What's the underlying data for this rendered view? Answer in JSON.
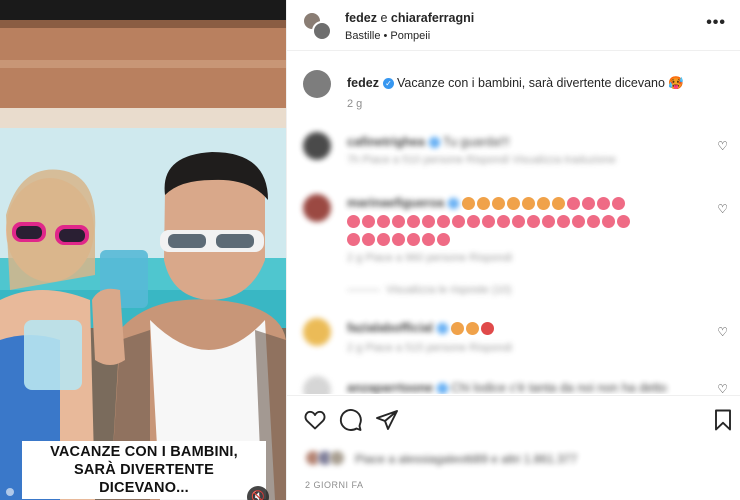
{
  "post": {
    "authors": {
      "first": "fedez",
      "conjunction": "e",
      "second": "chiaraferragni"
    },
    "location": "Bastille • Pompeii",
    "more_icon": "more-horizontal-icon",
    "caption": {
      "username": "fedez",
      "text": "Vacanze con i bambini, sarà divertente dicevano 🥵",
      "time": "2 g"
    },
    "media_overlay": {
      "line1": "VACANZE CON I BAMBINI,",
      "line2": "SARÀ DIVERTENTE DICEVANO..."
    },
    "date_label": "2 GIORNI FA"
  },
  "comments": [
    {
      "username": "cafinetrighea",
      "text": "Tu guarda!!!",
      "meta": "7h   Piace a 510 persone   Rispondi   Visualizza traduzione"
    },
    {
      "username": "marinaefigueroa",
      "meta": "2 g   Piace a 960 persone   Rispondi",
      "replies": "Visualizza le risposte (10)"
    },
    {
      "username": "fazialabofficial",
      "meta": "2 g   Piace a 515 persone   Rispondi"
    },
    {
      "username": "anzaparrtoone",
      "text": "Chi lodice c'è tanta da noi non ha detto"
    }
  ],
  "likes_text": "Piace a alessiagaleotti89 e altri 1.861.377",
  "colors": {
    "verified": "#3797f0",
    "muted": "#8e8e8e",
    "border": "#efefef"
  }
}
